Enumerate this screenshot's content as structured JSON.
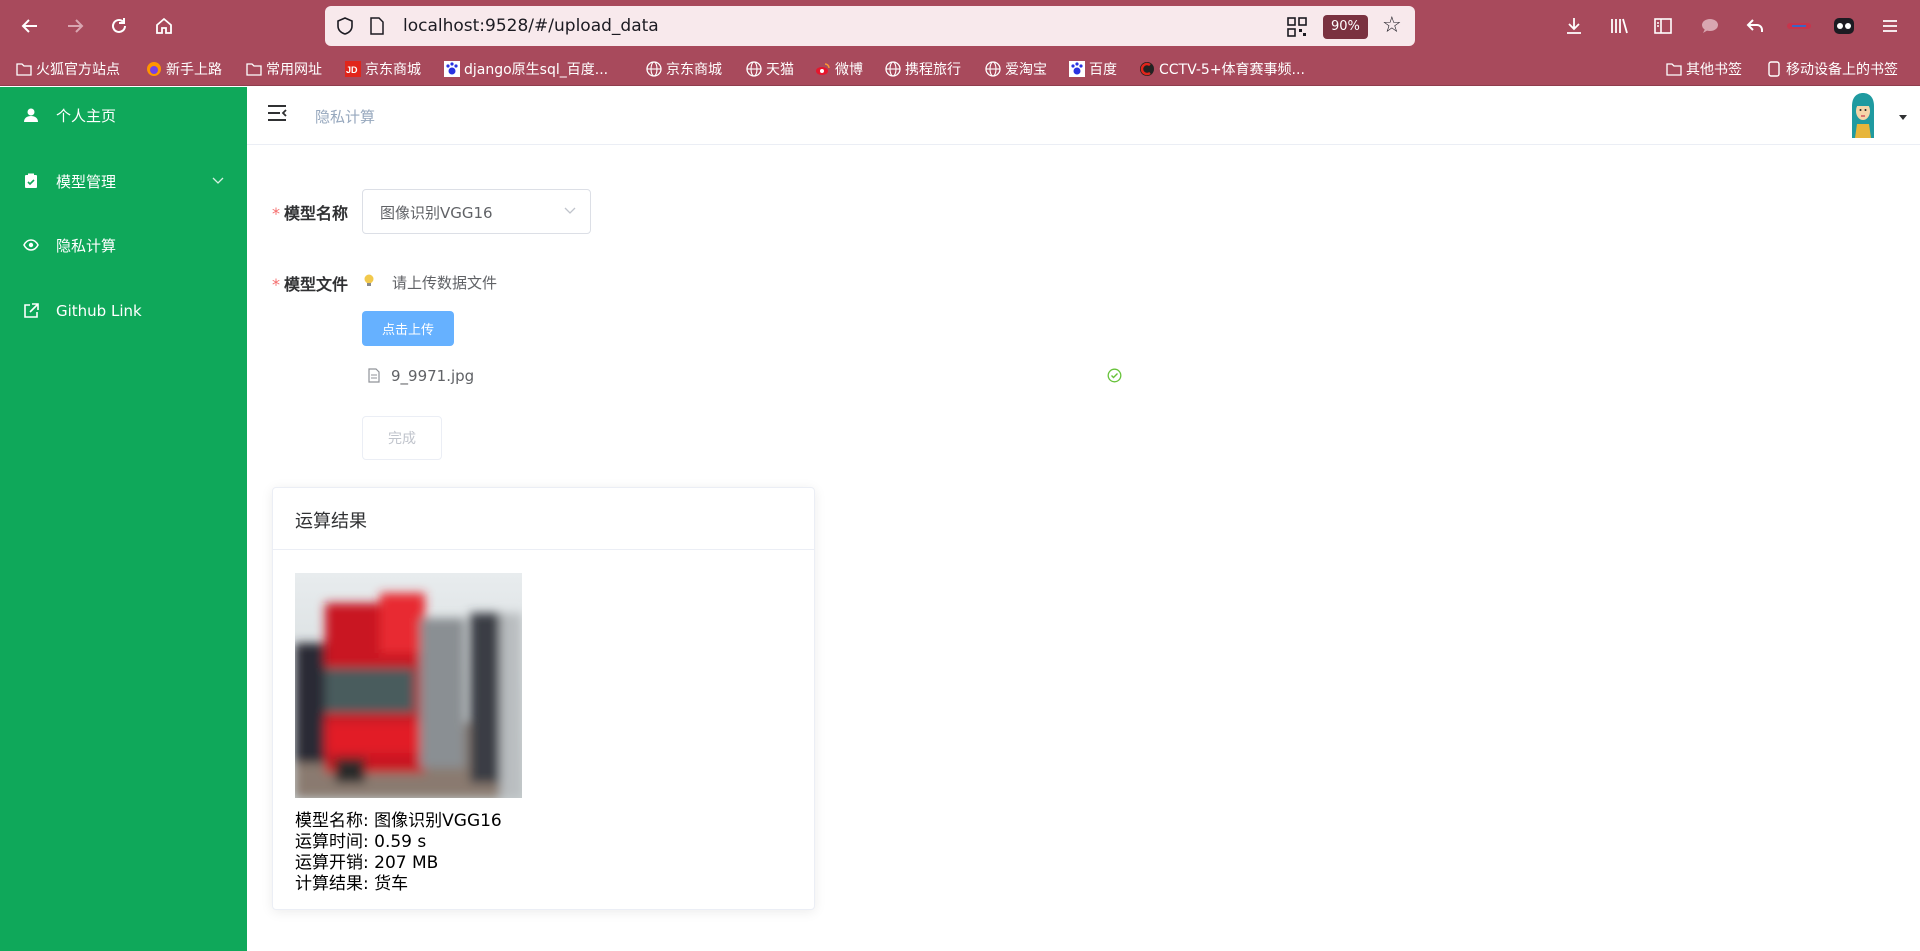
{
  "browser": {
    "url": "localhost:9528/#/upload_data",
    "zoom": "90%"
  },
  "bookmarks": [
    {
      "label": "火狐官方站点",
      "icon": "folder-icon"
    },
    {
      "label": "新手上路",
      "icon": "firefox-icon"
    },
    {
      "label": "常用网址",
      "icon": "folder-icon"
    },
    {
      "label": "京东商城",
      "icon": "jd-icon"
    },
    {
      "label": "django原生sql_百度...",
      "icon": "baidu-paw-icon"
    },
    {
      "label": "京东商城",
      "icon": "globe-icon"
    },
    {
      "label": "天猫",
      "icon": "globe-icon"
    },
    {
      "label": "微博",
      "icon": "weibo-icon"
    },
    {
      "label": "携程旅行",
      "icon": "globe-icon"
    },
    {
      "label": "爱淘宝",
      "icon": "globe-icon"
    },
    {
      "label": "百度",
      "icon": "baidu-paw-icon"
    },
    {
      "label": "CCTV-5+体育赛事频...",
      "icon": "cctv-icon"
    }
  ],
  "bookmarks_right": [
    {
      "label": "其他书签",
      "icon": "folder-icon"
    },
    {
      "label": "移动设备上的书签",
      "icon": "mobile-icon"
    }
  ],
  "sidebar": {
    "items": [
      {
        "label": "个人主页",
        "icon": "user-icon"
      },
      {
        "label": "模型管理",
        "icon": "clipboard-icon"
      },
      {
        "label": "隐私计算",
        "icon": "eye-icon"
      },
      {
        "label": "Github Link",
        "icon": "external-link-icon"
      }
    ]
  },
  "navbar": {
    "breadcrumb": "隐私计算"
  },
  "form": {
    "model_name_label": "模型名称",
    "model_name_value": "图像识别VGG16",
    "model_file_label": "模型文件",
    "upload_tip": "请上传数据文件",
    "upload_button": "点击上传",
    "uploaded_file": "9_9971.jpg",
    "done_button": "完成",
    "required_mark": "*"
  },
  "result": {
    "title": "运算结果",
    "rows": [
      {
        "label": "模型名称:",
        "value": "图像识别VGG16"
      },
      {
        "label": "运算时间:",
        "value": "0.59 s"
      },
      {
        "label": "运算开销:",
        "value": "207 MB"
      },
      {
        "label": "计算结果:",
        "value": "货车"
      }
    ]
  },
  "colors": {
    "browser_chrome": "#a84a5c",
    "sidebar": "#0fa85a",
    "primary_button": "#66b1ff",
    "required": "#f56c6c",
    "success": "#67c23a"
  }
}
